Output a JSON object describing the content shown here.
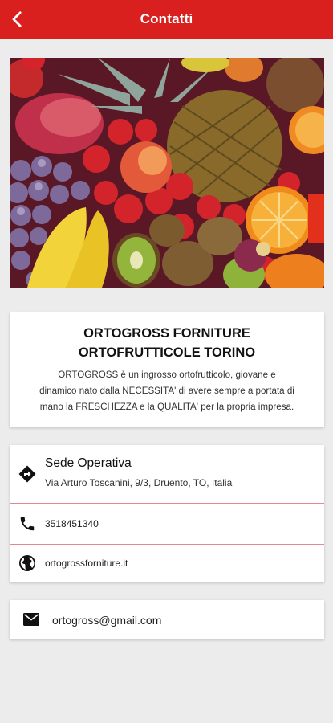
{
  "header": {
    "title": "Contatti",
    "back_icon": "back-arrow-icon",
    "color": "#d9201f"
  },
  "hero": {
    "image": "assorted-fruit-photo"
  },
  "about": {
    "company_name_line1": "ORTOGROSS FORNITURE",
    "company_name_line2": "ORTOFRUTTICOLE TORINO",
    "description_line1": "ORTOGROSS è un ingrosso ortofrutticolo, giovane e",
    "description_line2": "dinamico nato dalla NECESSITA' di avere sempre a portata di",
    "description_line3": "mano la FRESCHEZZA e la QUALITA' per la propria impresa."
  },
  "contacts": {
    "address": {
      "icon": "directions-icon",
      "title": "Sede Operativa",
      "value": "Via Arturo Toscanini, 9/3, Druento, TO, Italia"
    },
    "phone": {
      "icon": "phone-icon",
      "value": "3518451340"
    },
    "website": {
      "icon": "globe-icon",
      "value": "ortogrossforniture.it"
    },
    "email": {
      "icon": "mail-icon",
      "value": "ortogross@gmail.com"
    }
  }
}
